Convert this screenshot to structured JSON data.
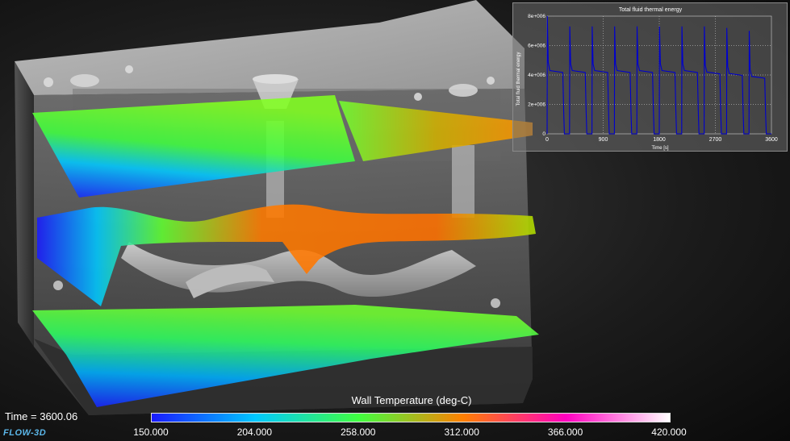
{
  "time_label": "Time = 3600.06",
  "logo_text": "FLOW-3D",
  "colorbar": {
    "title": "Wall Temperature (deg-C)",
    "ticks": [
      "150.000",
      "204.000",
      "258.000",
      "312.000",
      "366.000",
      "420.000"
    ],
    "colors": [
      "#1a1aff",
      "#00c8ff",
      "#40ff40",
      "#ff8000",
      "#ff00c0",
      "#ffffff"
    ]
  },
  "chart_data": {
    "type": "line",
    "title": "Total fluid thermal energy",
    "xlabel": "Time [s]",
    "ylabel": "Total fluid thermal energy",
    "xlim": [
      0,
      3600
    ],
    "ylim": [
      0,
      8000000
    ],
    "x_ticks": [
      "0",
      "900",
      "1800",
      "2700",
      "3600"
    ],
    "y_ticks": [
      "0",
      "2e+006",
      "4e+006",
      "6e+006",
      "8e+006"
    ],
    "grid": true,
    "series": [
      {
        "color": "#0000cc",
        "cycles": [
          {
            "start": 0,
            "peak": 8000000,
            "plateau": 4300000,
            "end": 360
          },
          {
            "start": 360,
            "peak": 7300000,
            "plateau": 4300000,
            "end": 720
          },
          {
            "start": 720,
            "peak": 7300000,
            "plateau": 4300000,
            "end": 1080
          },
          {
            "start": 1080,
            "peak": 7300000,
            "plateau": 4300000,
            "end": 1440
          },
          {
            "start": 1440,
            "peak": 7300000,
            "plateau": 4300000,
            "end": 1800
          },
          {
            "start": 1800,
            "peak": 7300000,
            "plateau": 4300000,
            "end": 2160
          },
          {
            "start": 2160,
            "peak": 7300000,
            "plateau": 4300000,
            "end": 2520
          },
          {
            "start": 2520,
            "peak": 7300000,
            "plateau": 4200000,
            "end": 2880
          },
          {
            "start": 2880,
            "peak": 7200000,
            "plateau": 4100000,
            "end": 3240
          },
          {
            "start": 3240,
            "peak": 7000000,
            "plateau": 3900000,
            "end": 3600
          }
        ]
      }
    ]
  }
}
